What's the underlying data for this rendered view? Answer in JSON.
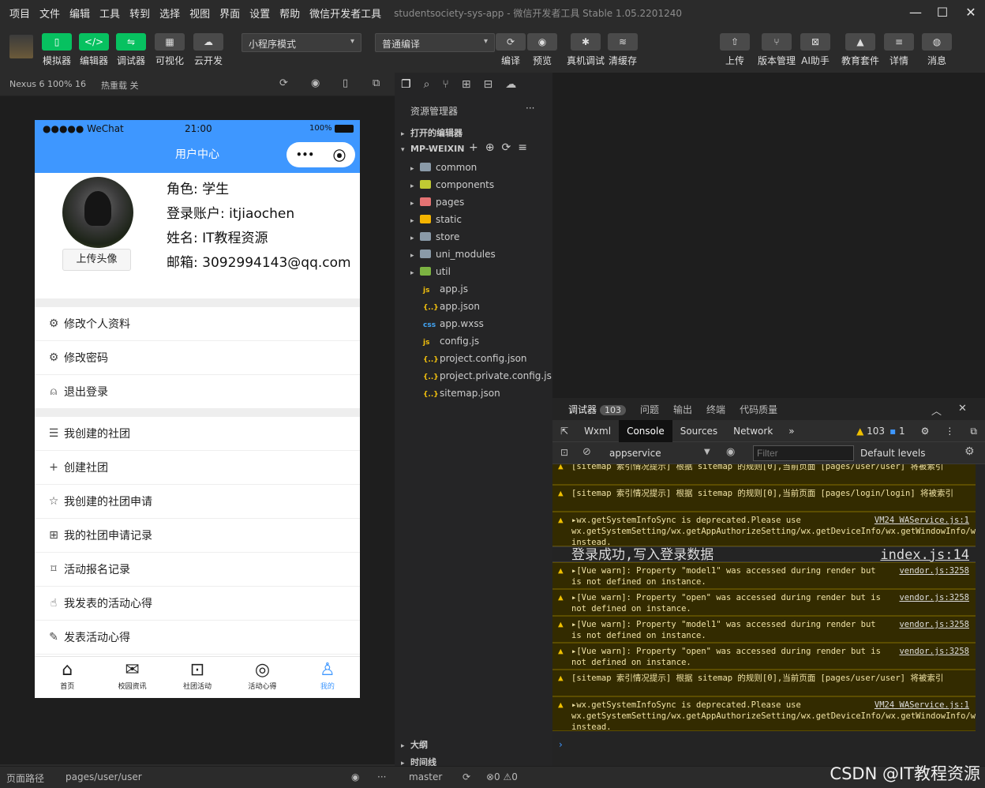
{
  "menubar": {
    "items": [
      "项目",
      "文件",
      "编辑",
      "工具",
      "转到",
      "选择",
      "视图",
      "界面",
      "设置",
      "帮助",
      "微信开发者工具"
    ],
    "window_title": "studentsociety-sys-app - 微信开发者工具 Stable 1.05.2201240"
  },
  "toolbar": {
    "left_buttons": [
      {
        "label": "模拟器",
        "icon": "phone-icon"
      },
      {
        "label": "编辑器",
        "icon": "code-icon"
      },
      {
        "label": "调试器",
        "icon": "debug-icon"
      },
      {
        "label": "可视化",
        "icon": "layout-icon"
      },
      {
        "label": "云开发",
        "icon": "cloud-icon"
      }
    ],
    "mode_select": "小程序模式",
    "compile_select": "普通编译",
    "mid_buttons": [
      {
        "label": "编译",
        "icon": "refresh-icon"
      },
      {
        "label": "预览",
        "icon": "eye-icon"
      },
      {
        "label": "真机调试",
        "icon": "bug-icon"
      },
      {
        "label": "清缓存",
        "icon": "layers-icon"
      }
    ],
    "right_buttons": [
      {
        "label": "上传",
        "icon": "upload-icon"
      },
      {
        "label": "版本管理",
        "icon": "branch-icon"
      },
      {
        "label": "AI助手",
        "icon": "ai-icon"
      },
      {
        "label": "教育套件",
        "icon": "graduation-icon"
      },
      {
        "label": "详情",
        "icon": "menu-icon"
      },
      {
        "label": "消息",
        "icon": "bell-icon"
      }
    ]
  },
  "simulator": {
    "device": "Nexus 6 100% 16",
    "hot_reload": "热重载 关",
    "status": {
      "carrier": "●●●●● WeChat",
      "time": "21:00",
      "battery": "100%"
    },
    "nav_title": "用户中心",
    "profile": {
      "upload_button": "上传头像",
      "role": "角色:  学生",
      "account": "登录账户:  itjiaochen",
      "name": "姓名:  IT教程资源",
      "email": "邮箱:  3092994143@qq.com"
    },
    "menu_group1": [
      {
        "label": "修改个人资料",
        "icon": "gear-outline-icon"
      },
      {
        "label": "修改密码",
        "icon": "gear-filled-icon"
      },
      {
        "label": "退出登录",
        "icon": "user-logout-icon"
      }
    ],
    "menu_group2": [
      {
        "label": "我创建的社团",
        "icon": "list-icon"
      },
      {
        "label": "创建社团",
        "icon": "plus-icon"
      },
      {
        "label": "我创建的社团申请",
        "icon": "star-icon"
      },
      {
        "label": "我的社团申请记录",
        "icon": "grid-icon"
      },
      {
        "label": "活动报名记录",
        "icon": "bookmark-icon"
      },
      {
        "label": "我发表的活动心得",
        "icon": "thumb-up-icon"
      },
      {
        "label": "发表活动心得",
        "icon": "pen-icon"
      }
    ],
    "tabs": [
      {
        "label": "首页",
        "icon": "home-icon"
      },
      {
        "label": "校园资讯",
        "icon": "news-icon"
      },
      {
        "label": "社团活动",
        "icon": "activity-icon"
      },
      {
        "label": "活动心得",
        "icon": "aperture-icon"
      },
      {
        "label": "我的",
        "icon": "person-icon"
      }
    ]
  },
  "explorer": {
    "title": "资源管理器",
    "open_editors": "打开的编辑器",
    "project": "MP-WEIXIN",
    "folders": [
      {
        "name": "common",
        "color": "#8a9aa8"
      },
      {
        "name": "components",
        "color": "#c0ca33"
      },
      {
        "name": "pages",
        "color": "#e57373"
      },
      {
        "name": "static",
        "color": "#f4b400"
      },
      {
        "name": "store",
        "color": "#8a9aa8"
      },
      {
        "name": "uni_modules",
        "color": "#8a9aa8"
      },
      {
        "name": "util",
        "color": "#7cb342"
      }
    ],
    "files": [
      {
        "name": "app.js",
        "icon": "js",
        "color": "#f4c20d"
      },
      {
        "name": "app.json",
        "icon": "{..}",
        "color": "#f4c20d"
      },
      {
        "name": "app.wxss",
        "icon": "css",
        "color": "#42a5f5"
      },
      {
        "name": "config.js",
        "icon": "js",
        "color": "#f4c20d"
      },
      {
        "name": "project.config.json",
        "icon": "{..}",
        "color": "#f4c20d"
      },
      {
        "name": "project.private.config.js...",
        "icon": "{..}",
        "color": "#f4c20d"
      },
      {
        "name": "sitemap.json",
        "icon": "{..}",
        "color": "#f4c20d"
      }
    ],
    "outline": "大纲",
    "timeline": "时间线"
  },
  "devtools": {
    "tabs": [
      "调试器",
      "问题",
      "输出",
      "终端",
      "代码质量"
    ],
    "debugger_count": "103",
    "console_tabs": [
      "Wxml",
      "Console",
      "Sources",
      "Network"
    ],
    "warn_count": "103",
    "info_count": "1",
    "context": "appservice",
    "filter_placeholder": "Filter",
    "levels": "Default levels",
    "messages": [
      {
        "type": "warn",
        "text": "[sitemap 索引情况提示] 根据 sitemap 的规则[0],当前页面 [pages/user/user] 将被索引",
        "src": ""
      },
      {
        "type": "warn",
        "text": "[sitemap 索引情况提示] 根据 sitemap 的规则[0],当前页面 [pages/login/login] 将被索引",
        "src": ""
      },
      {
        "type": "warn",
        "text": "▸wx.getSystemInfoSync is deprecated.Please use wx.getSystemSetting/wx.getAppAuthorizeSetting/wx.getDeviceInfo/wx.getWindowInfo/wx.getAppBaseInfo instead.",
        "src": "VM24 WAService.js:1"
      },
      {
        "type": "info",
        "text": "登录成功,写入登录数据",
        "src": "index.js:14"
      },
      {
        "type": "warn",
        "text": "▸[Vue warn]: Property \"model1\" was accessed during render but is not defined on instance.",
        "src": "vendor.js:3258"
      },
      {
        "type": "warn",
        "text": "▸[Vue warn]: Property \"open\" was accessed during render but is not defined on instance.",
        "src": "vendor.js:3258"
      },
      {
        "type": "warn",
        "text": "▸[Vue warn]: Property \"model1\" was accessed during render but is not defined on instance.",
        "src": "vendor.js:3258"
      },
      {
        "type": "warn",
        "text": "▸[Vue warn]: Property \"open\" was accessed during render but is not defined on instance.",
        "src": "vendor.js:3258"
      },
      {
        "type": "warn",
        "text": "[sitemap 索引情况提示] 根据 sitemap 的规则[0],当前页面 [pages/user/user] 将被索引",
        "src": ""
      },
      {
        "type": "warn",
        "text": "▸wx.getSystemInfoSync is deprecated.Please use wx.getSystemSetting/wx.getAppAuthorizeSetting/wx.getDeviceInfo/wx.getWindowInfo/wx.getAppBaseInfo instead.",
        "src": "VM24 WAService.js:1"
      }
    ]
  },
  "statusbar": {
    "page_path_label": "页面路径",
    "page_path": "pages/user/user",
    "branch": "master",
    "problems": "⊗0 ⚠0"
  },
  "watermark": "CSDN @IT教程资源"
}
